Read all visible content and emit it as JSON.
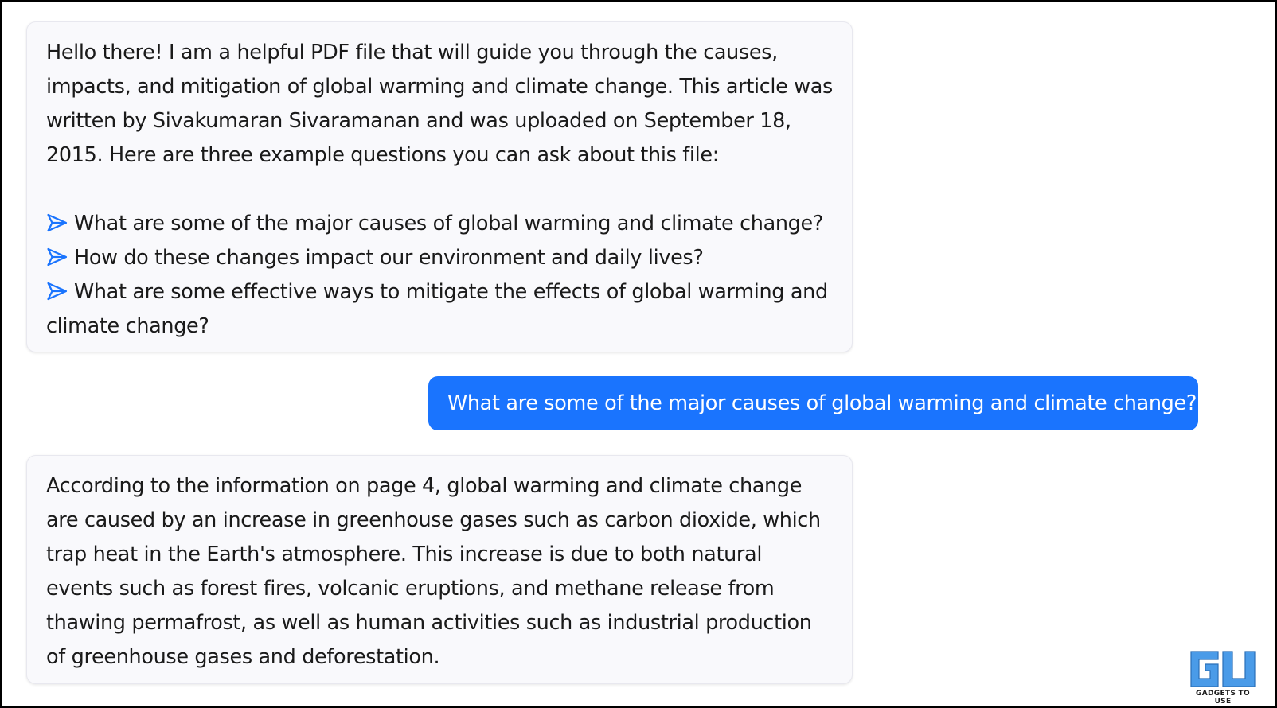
{
  "messages": [
    {
      "role": "assistant",
      "intro": "Hello there! I am a helpful PDF file that will guide you through the causes, impacts, and mitigation of global warming and climate change. This article was written by Sivakumaran Sivaramanan and was uploaded on September 18, 2015. Here are three example questions you can ask about this file:",
      "suggestions": [
        "What are some of the major causes of global warming and climate change?",
        "How do these changes impact our environment and daily lives?",
        "What are some effective ways to mitigate the effects of global warming and climate change?"
      ],
      "suggestion_icon": "send-arrow-icon"
    },
    {
      "role": "user",
      "text": "What are some of the major causes of global warming and climate change?"
    },
    {
      "role": "assistant",
      "text": "According to the information on page 4, global warming and climate change are caused by an increase in greenhouse gases such as carbon dioxide, which trap heat in the Earth's atmosphere. This increase is due to both natural events such as forest fires, volcanic eruptions, and methane release from thawing permafrost, as well as human activities such as industrial production of greenhouse gases and deforestation."
    }
  ],
  "watermark": {
    "logo_icon": "gadgets-to-use-logo-icon",
    "caption": "GADGETS TO USE"
  },
  "colors": {
    "user_bubble": "#1a74fe",
    "bot_bubble": "#f9f9fc",
    "arrow": "#1a74fe",
    "logo": "#4a9be8"
  }
}
